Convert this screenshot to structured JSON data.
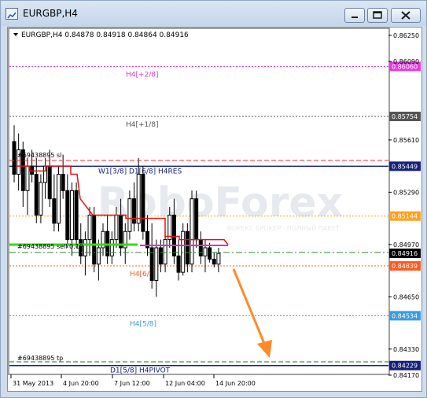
{
  "window": {
    "title": "EURGBP,H4"
  },
  "chart": {
    "header": "EURGBP,H4  0.84878 0.84918 0.84864 0.84916",
    "watermark": "RoboForex",
    "watermark_sub": "ФОРЕКС БРОКЕР · ПОЛНЫЙ ПАКЕТ",
    "price_axis": [
      "0.86250",
      "0.85610",
      "0.85290",
      "0.84970",
      "0.84650",
      "0.84330",
      "0.84170"
    ],
    "price_axis_top_extra": "0.86090",
    "time_axis": [
      "31 May 2013",
      "4 Jun 20:00",
      "7 Jun 12:00",
      "12 Jun 04:00",
      "14 Jun 20:00"
    ],
    "levels": [
      {
        "label": "H4[+2/8]",
        "price": "0.86060",
        "color": "#e23ae0"
      },
      {
        "label": "H4[+1/8]",
        "price": "0.85754",
        "color": "#555555"
      },
      {
        "label": "W1[3/8] D1[6/8] H4RES",
        "price": "0.85449",
        "color": "#14207a"
      },
      {
        "label": "",
        "price": "0.85144",
        "color": "#ffa21f"
      },
      {
        "label": "H4[6/8]",
        "price": "0.84839",
        "color": "#ff5a1f"
      },
      {
        "label": "H4[5/8]",
        "price": "0.84534",
        "color": "#3a9be0"
      },
      {
        "label": "D1[5/8] H4PIVOT",
        "price": "0.84229",
        "color": "#14207a"
      }
    ],
    "current_price": "0.84916",
    "orders": {
      "open_label": "#69438895 sell 0.10",
      "tp_label": "#69438895 tp",
      "sl_label": "#69438895 sl"
    }
  }
}
